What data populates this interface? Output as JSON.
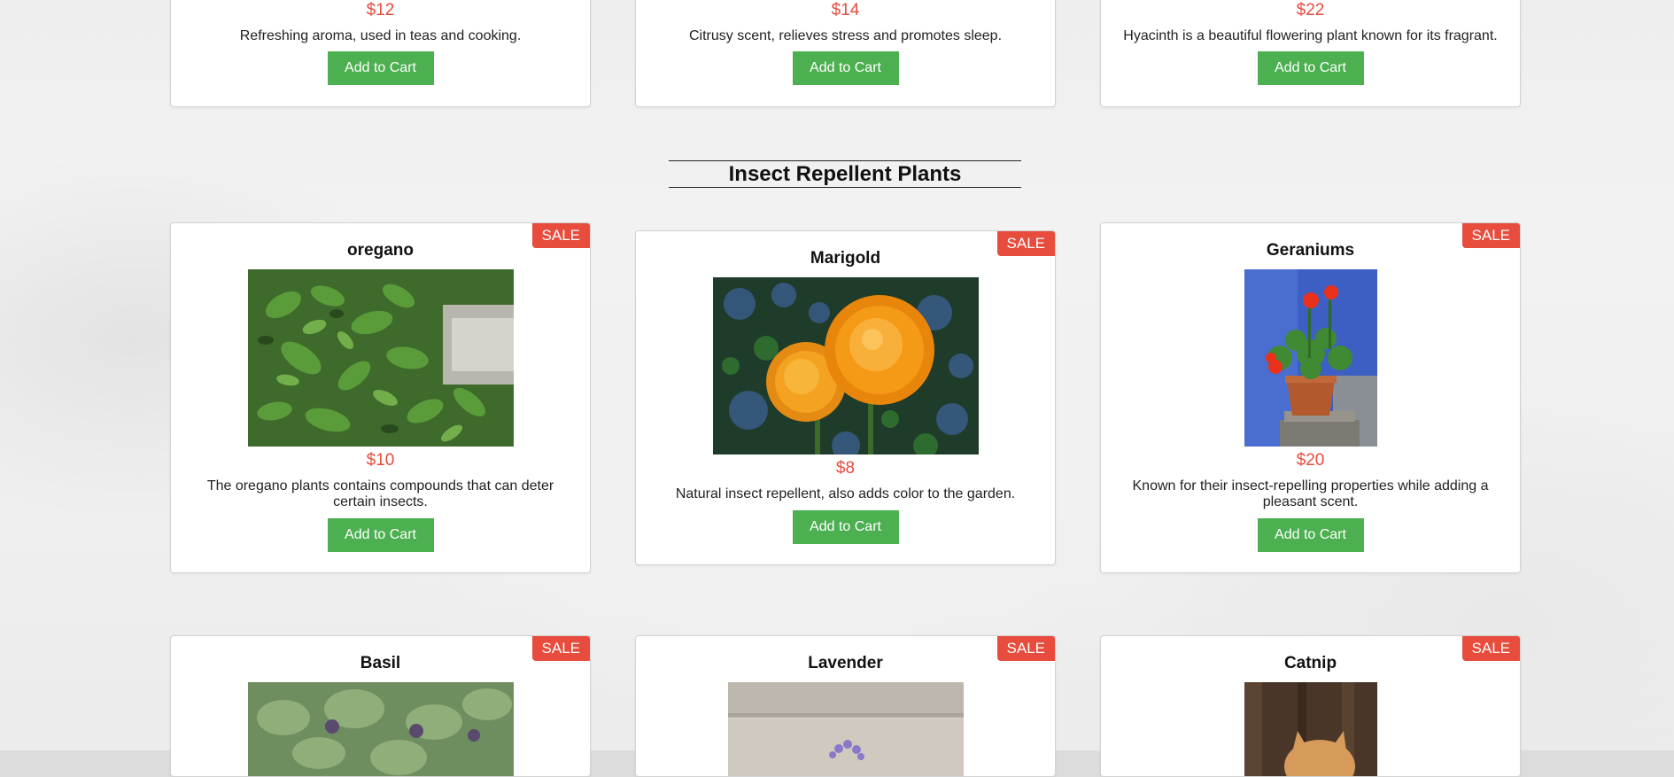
{
  "top_row": [
    {
      "price": "$12",
      "description": "Refreshing aroma, used in teas and cooking.",
      "button": "Add to Cart"
    },
    {
      "price": "$14",
      "description": "Citrusy scent, relieves stress and promotes sleep.",
      "button": "Add to Cart"
    },
    {
      "price": "$22",
      "description": "Hyacinth is a beautiful flowering plant known for its fragrant.",
      "button": "Add to Cart"
    }
  ],
  "section_title": "Insect Repellent Plants",
  "insect_row": [
    {
      "badge": "SALE",
      "name": "oregano",
      "price": "$10",
      "description": "The oregano plants contains compounds that can deter certain insects.",
      "button": "Add to Cart"
    },
    {
      "badge": "SALE",
      "name": "Marigold",
      "price": "$8",
      "description": "Natural insect repellent, also adds color to the garden.",
      "button": "Add to Cart"
    },
    {
      "badge": "SALE",
      "name": "Geraniums",
      "price": "$20",
      "description": "Known for their insect-repelling properties while adding a pleasant scent.",
      "button": "Add to Cart"
    }
  ],
  "bottom_row": [
    {
      "badge": "SALE",
      "name": "Basil"
    },
    {
      "badge": "SALE",
      "name": "Lavender"
    },
    {
      "badge": "SALE",
      "name": "Catnip"
    }
  ],
  "colors": {
    "price": "#e74c3c",
    "sale_badge": "#e74c3c",
    "button": "#4caf50"
  },
  "icons": [
    "oregano-image",
    "marigold-image",
    "geraniums-image",
    "basil-image",
    "lavender-image",
    "catnip-image"
  ]
}
